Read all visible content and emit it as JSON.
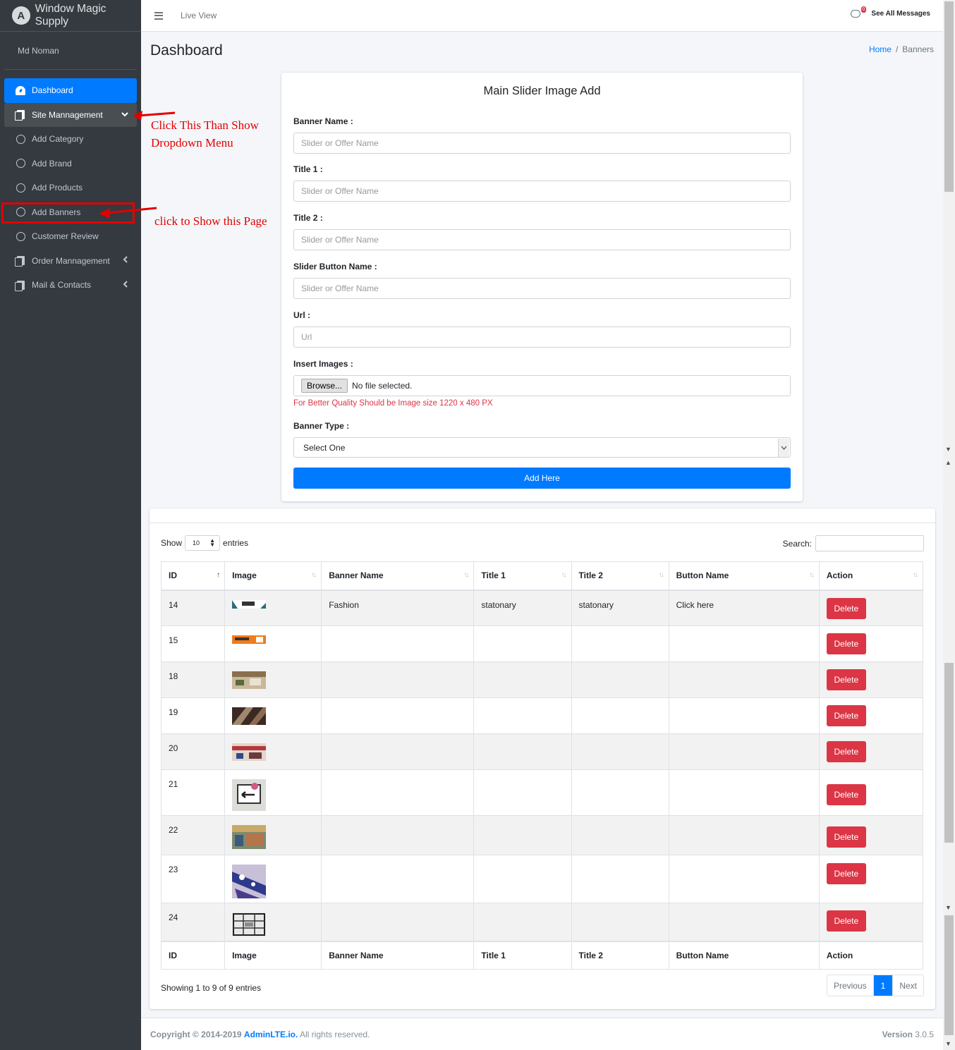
{
  "brand": {
    "name": "Window Magic Supply",
    "logo_letter": "A"
  },
  "user": {
    "name": "Md Noman"
  },
  "sidebar": {
    "items": [
      {
        "label": "Dashboard"
      },
      {
        "label": "Site Mannagement"
      },
      {
        "label": "Add Category"
      },
      {
        "label": "Add Brand"
      },
      {
        "label": "Add Products"
      },
      {
        "label": "Add Banners"
      },
      {
        "label": "Customer Review"
      },
      {
        "label": "Order Mannagement"
      },
      {
        "label": "Mail & Contacts"
      }
    ]
  },
  "topbar": {
    "live_view": "Live View",
    "message_count": "0",
    "see_all": "See All Messages"
  },
  "page": {
    "title": "Dashboard",
    "breadcrumb_home": "Home",
    "breadcrumb_sep": "/",
    "breadcrumb_current": "Banners"
  },
  "form": {
    "title": "Main Slider Image Add",
    "banner_name_label": "Banner Name :",
    "title1_label": "Title 1 :",
    "title2_label": "Title 2 :",
    "button_name_label": "Slider Button Name :",
    "url_label": "Url :",
    "images_label": "Insert Images :",
    "placeholder_name": "Slider or Offer Name",
    "placeholder_url": "Url",
    "browse_label": "Browse...",
    "no_file": "No file selected.",
    "image_hint": "For Better Quality Should be Image size 1220 x 480 PX",
    "type_label": "Banner Type :",
    "type_selected": "Select One",
    "submit_label": "Add Here"
  },
  "table": {
    "show_label": "Show",
    "entries_value": "10",
    "entries_label": "entries",
    "search_label": "Search:",
    "columns": [
      "ID",
      "Image",
      "Banner Name",
      "Title 1",
      "Title 2",
      "Button Name",
      "Action"
    ],
    "rows": [
      {
        "id": "14",
        "banner_name": "Fashion",
        "title1": "statonary",
        "title2": "statonary",
        "button_name": "Click here",
        "action": "Delete"
      },
      {
        "id": "15",
        "banner_name": "",
        "title1": "",
        "title2": "",
        "button_name": "",
        "action": "Delete"
      },
      {
        "id": "18",
        "banner_name": "",
        "title1": "",
        "title2": "",
        "button_name": "",
        "action": "Delete"
      },
      {
        "id": "19",
        "banner_name": "",
        "title1": "",
        "title2": "",
        "button_name": "",
        "action": "Delete"
      },
      {
        "id": "20",
        "banner_name": "",
        "title1": "",
        "title2": "",
        "button_name": "",
        "action": "Delete"
      },
      {
        "id": "21",
        "banner_name": "",
        "title1": "",
        "title2": "",
        "button_name": "",
        "action": "Delete"
      },
      {
        "id": "22",
        "banner_name": "",
        "title1": "",
        "title2": "",
        "button_name": "",
        "action": "Delete"
      },
      {
        "id": "23",
        "banner_name": "",
        "title1": "",
        "title2": "",
        "button_name": "",
        "action": "Delete"
      },
      {
        "id": "24",
        "banner_name": "",
        "title1": "",
        "title2": "",
        "button_name": "",
        "action": "Delete"
      }
    ],
    "info": "Showing 1 to 9 of 9 entries",
    "prev_label": "Previous",
    "current_page": "1",
    "next_label": "Next"
  },
  "footer": {
    "copyright": "Copyright © 2014-2019",
    "link": "AdminLTE.io.",
    "rights": "All rights reserved.",
    "version_label": "Version",
    "version": "3.0.5"
  },
  "annotations": {
    "note1_line1": "Click This Than Show",
    "note1_line2": "Dropdown Menu",
    "note2": "click to Show this Page"
  },
  "colors": {
    "primary": "#007bff",
    "danger": "#dc3545",
    "sidebar": "#343a40",
    "annotation": "#e30000"
  }
}
